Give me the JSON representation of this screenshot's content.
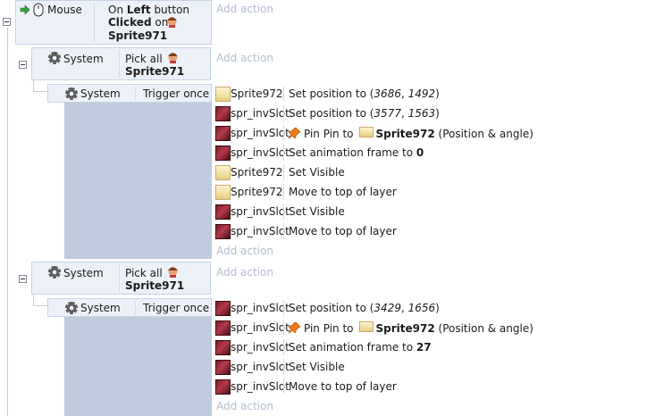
{
  "event1": {
    "condition": {
      "object": "Mouse",
      "line1_pre": "On ",
      "line1_bold": "Left",
      "line1_post": " button",
      "line2_bold": "Clicked",
      "line2_post": " on",
      "target": "Sprite971"
    },
    "add_action": "Add action"
  },
  "group1": {
    "condition": {
      "object": "System",
      "text": "Pick all",
      "target": "Sprite971"
    },
    "add_action": "Add action",
    "sub": {
      "condition": {
        "object": "System",
        "text": "Trigger once"
      },
      "actions": [
        {
          "icon": "sprite",
          "object": "Sprite972",
          "desc_pre": "Set position to (",
          "x": "3686",
          "comma": ", ",
          "y": "1492",
          "desc_post": ")"
        },
        {
          "icon": "slot",
          "object": "spr_invSlot",
          "desc_pre": "Set position to (",
          "x": "3577",
          "comma": ", ",
          "y": "1563",
          "desc_post": ")"
        },
        {
          "icon": "slot",
          "object": "spr_invSlot",
          "pin": true,
          "desc_pre": "Pin Pin to",
          "target": "Sprite972",
          "desc_post": "(Position & angle)"
        },
        {
          "icon": "slot",
          "object": "spr_invSlot",
          "desc_pre": "Set animation frame to ",
          "bold": "0"
        },
        {
          "icon": "sprite",
          "object": "Sprite972",
          "desc_pre": "Set Visible"
        },
        {
          "icon": "sprite",
          "object": "Sprite972",
          "desc_pre": "Move to top of layer"
        },
        {
          "icon": "slot",
          "object": "spr_invSlot",
          "desc_pre": "Set Visible"
        },
        {
          "icon": "slot",
          "object": "spr_invSlot",
          "desc_pre": "Move to top of layer"
        }
      ],
      "add_action": "Add action"
    }
  },
  "group2": {
    "condition": {
      "object": "System",
      "text": "Pick all",
      "target": "Sprite971"
    },
    "add_action": "Add action",
    "sub": {
      "condition": {
        "object": "System",
        "text": "Trigger once"
      },
      "actions": [
        {
          "icon": "slot",
          "object": "spr_invSlot",
          "desc_pre": "Set position to (",
          "x": "3429",
          "comma": ", ",
          "y": "1656",
          "desc_post": ")"
        },
        {
          "icon": "slot",
          "object": "spr_invSlot",
          "pin": true,
          "desc_pre": "Pin Pin to",
          "target": "Sprite972",
          "desc_post": "(Position & angle)"
        },
        {
          "icon": "slot",
          "object": "spr_invSlot",
          "desc_pre": "Set animation frame to ",
          "bold": "27"
        },
        {
          "icon": "slot",
          "object": "spr_invSlot",
          "desc_pre": "Set Visible"
        },
        {
          "icon": "slot",
          "object": "spr_invSlot",
          "desc_pre": "Move to top of layer"
        }
      ],
      "add_action": "Add action"
    }
  }
}
